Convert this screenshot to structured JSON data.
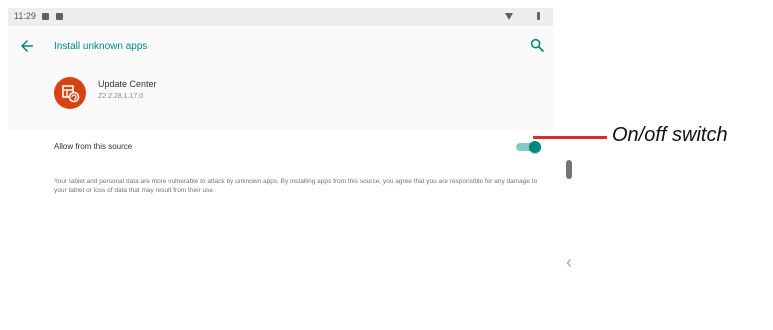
{
  "status_bar": {
    "time": "11:29"
  },
  "app_bar": {
    "title": "Install unknown apps"
  },
  "app": {
    "name": "Update Center",
    "version": "Z2.2.28.1.17.0"
  },
  "setting": {
    "label": "Allow from this source",
    "enabled": true,
    "warning": "Your tablet and personal data are more vulnerable to attack by unknown apps. By installing apps from this source, you agree that you are responsible for any damage to your tablet or loss of data that may result from their use."
  },
  "annotation": {
    "label": "On/off switch"
  },
  "colors": {
    "accent": "#00897b",
    "switch_track": "#80cbc4",
    "app_icon": "#d84315",
    "callout": "#d32f2f"
  },
  "icons": {
    "back": "arrow-back-icon",
    "search": "search-icon",
    "app": "update-center-icon",
    "side": "chevron-left-icon"
  }
}
